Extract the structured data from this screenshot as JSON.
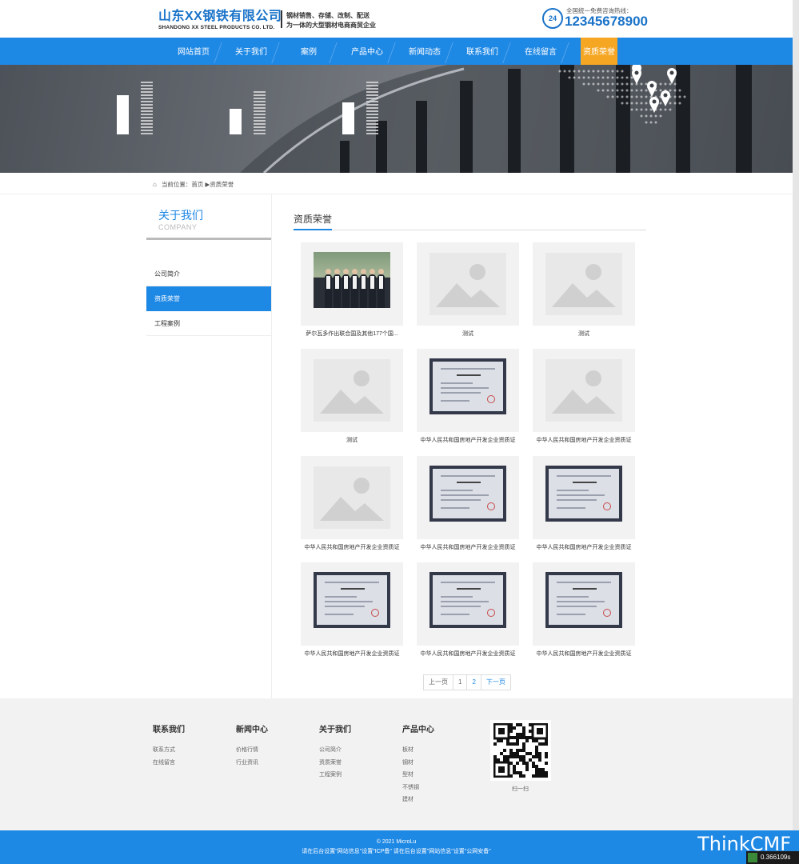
{
  "header": {
    "logo_cn": "山东XX钢铁有限公司",
    "logo_en": "SHANDONG XX STEEL PRODUCTS CO. LTD.",
    "slogan_line1": "钢材销售、存储、改制、配送",
    "slogan_line2": "为一体的大型钢材电商商贸企业",
    "hotline_badge": "24",
    "hotline_label": "全国统一免费咨询热线：",
    "hotline_number": "12345678900"
  },
  "nav": {
    "items": [
      {
        "label": "网站首页"
      },
      {
        "label": "关于我们"
      },
      {
        "label": "案例"
      },
      {
        "label": "产品中心"
      },
      {
        "label": "新闻动态"
      },
      {
        "label": "联系我们"
      },
      {
        "label": "在线留言"
      },
      {
        "label": "资质荣誉"
      }
    ],
    "active_color": "#f5a623",
    "bar_color": "#1e88e5"
  },
  "breadcrumb": {
    "text": "当前位置：首页 ▶资质荣誉"
  },
  "sidebar": {
    "title": "关于我们",
    "subtitle": "COMPANY",
    "items": [
      {
        "label": "公司简介"
      },
      {
        "label": "资质荣誉"
      },
      {
        "label": "工程案例"
      }
    ]
  },
  "main": {
    "title": "资质荣誉",
    "cards": [
      {
        "caption": "萨尔瓦多作出联合国及其他177个国...",
        "image": "team-photo"
      },
      {
        "caption": "测试",
        "image": "placeholder"
      },
      {
        "caption": "测试",
        "image": "placeholder"
      },
      {
        "caption": "测试",
        "image": "placeholder"
      },
      {
        "caption": "中华人民共和国房地产开发企业资质证",
        "image": "certificate"
      },
      {
        "caption": "中华人民共和国房地产开发企业资质证",
        "image": "placeholder"
      },
      {
        "caption": "中华人民共和国房地产开发企业资质证",
        "image": "placeholder"
      },
      {
        "caption": "中华人民共和国房地产开发企业资质证",
        "image": "certificate"
      },
      {
        "caption": "中华人民共和国房地产开发企业资质证",
        "image": "certificate"
      },
      {
        "caption": "中华人民共和国房地产开发企业资质证",
        "image": "certificate"
      },
      {
        "caption": "中华人民共和国房地产开发企业资质证",
        "image": "certificate"
      },
      {
        "caption": "中华人民共和国房地产开发企业资质证",
        "image": "certificate"
      }
    ]
  },
  "pagination": {
    "prev": "上一页",
    "page1": "1",
    "page2": "2",
    "next": "下一页"
  },
  "footer": {
    "columns": [
      {
        "heading": "联系我们",
        "links": [
          "联系方式",
          "在线留言"
        ]
      },
      {
        "heading": "新闻中心",
        "links": [
          "价格行情",
          "行业资讯"
        ]
      },
      {
        "heading": "关于我们",
        "links": [
          "公司简介",
          "资质荣誉",
          "工程案例"
        ]
      },
      {
        "heading": "产品中心",
        "links": [
          "板材",
          "钢材",
          "型材",
          "不锈钢",
          "建材"
        ]
      }
    ],
    "qr_label": "扫一扫",
    "copyright": "© 2021 MicroLu",
    "icp_line": "请在后台设置\"网站信息\"设置\"ICP备\" 请在后台设置\"网站信息\"设置\"公网安备\""
  },
  "overlay": {
    "brand": "ThinkCMF",
    "timer": "0.366109s"
  }
}
